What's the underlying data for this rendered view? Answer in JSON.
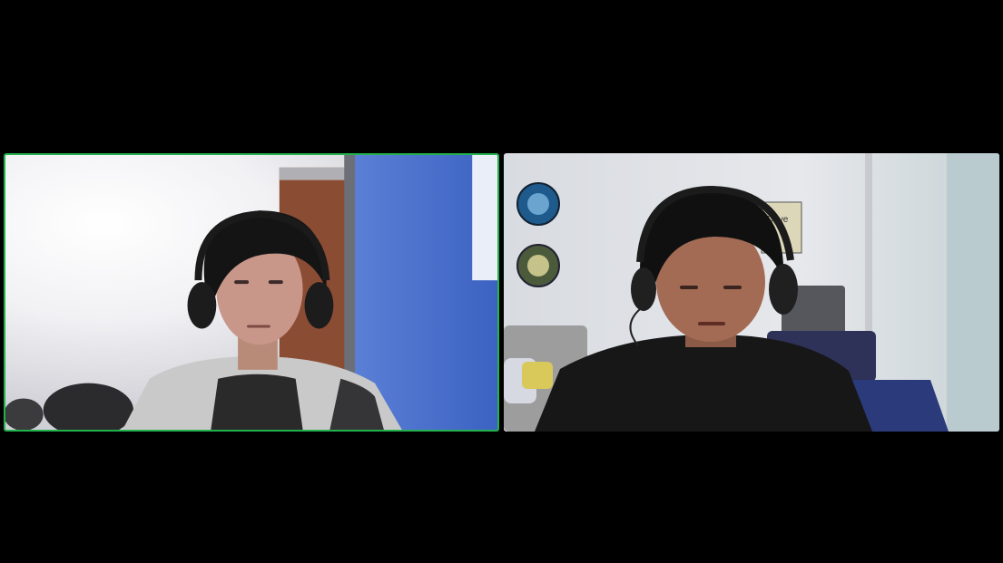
{
  "meeting": {
    "layout": "gallery",
    "participants": [
      {
        "id": "participant-1",
        "active_speaker": true
      },
      {
        "id": "participant-2",
        "active_speaker": false
      }
    ]
  },
  "colors": {
    "background": "#000000",
    "active_speaker_border": "#23b14d"
  },
  "wall_signs": [
    {
      "text": "Drive"
    }
  ]
}
